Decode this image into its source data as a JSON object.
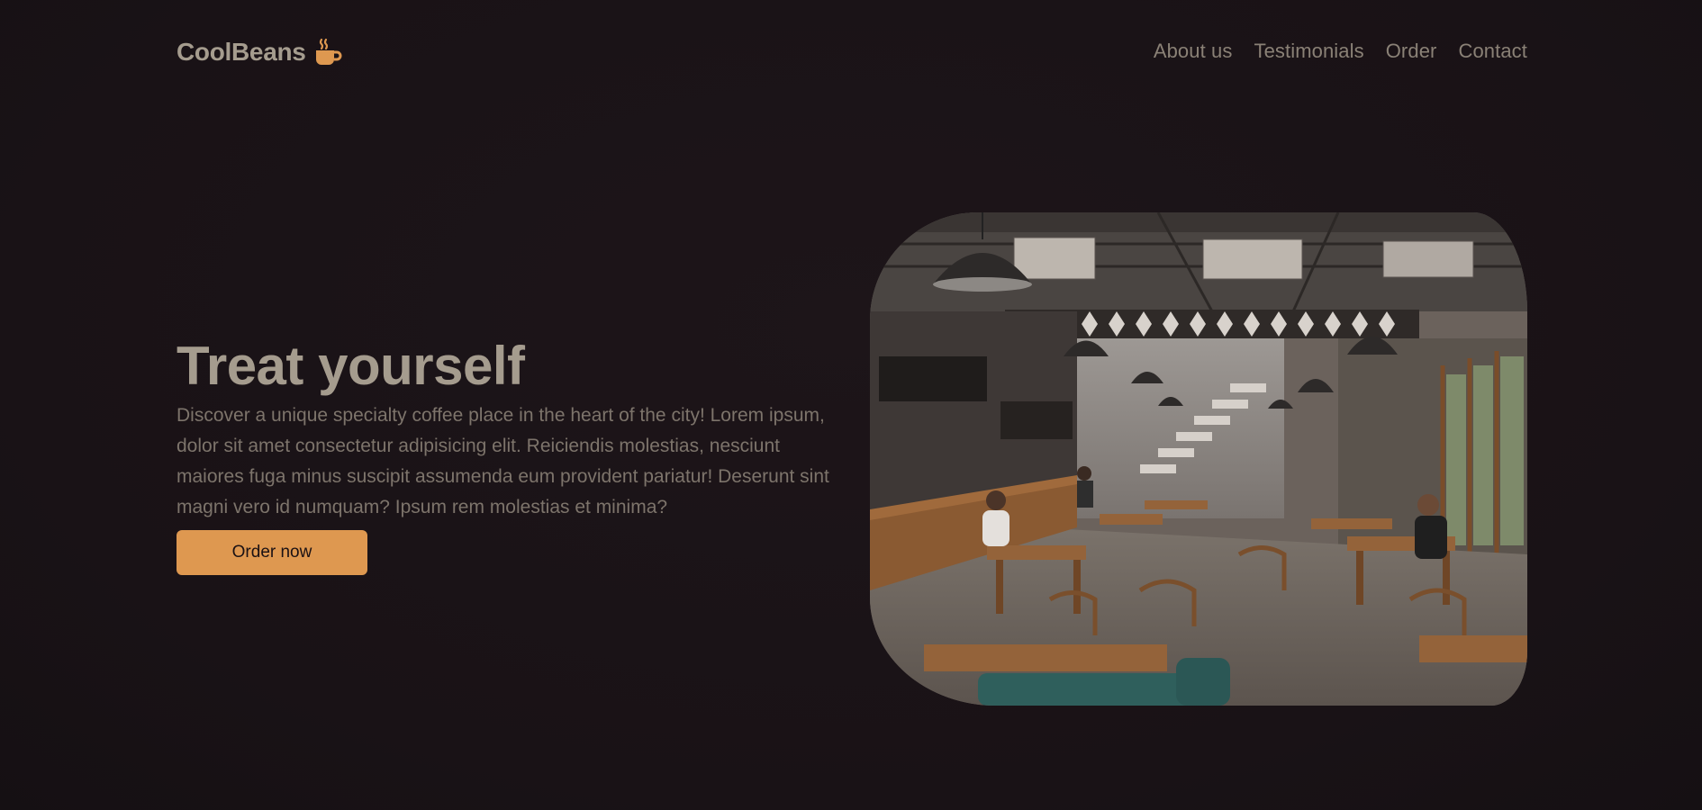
{
  "brand": {
    "name": "CoolBeans",
    "icon": "coffee-cup-icon",
    "color": "#de9850"
  },
  "nav": {
    "items": [
      {
        "label": "About us"
      },
      {
        "label": "Testimonials"
      },
      {
        "label": "Order"
      },
      {
        "label": "Contact"
      }
    ]
  },
  "hero": {
    "title": "Treat yourself",
    "description": "Discover a unique specialty coffee place in the heart of the city! Lorem ipsum, dolor sit amet consectetur adipisicing elit. Reiciendis molestias, nesciunt maiores fuga minus suscipit assumenda eum provident pariatur! Deserunt sint magni vero id numquam? Ipsum rem molestias et minima?",
    "cta_label": "Order now",
    "image_icon": "cafe-interior-photo"
  },
  "colors": {
    "background": "#1b1418",
    "accent": "#de9850",
    "heading": "#a59c8e",
    "body_text": "#7d746b"
  }
}
